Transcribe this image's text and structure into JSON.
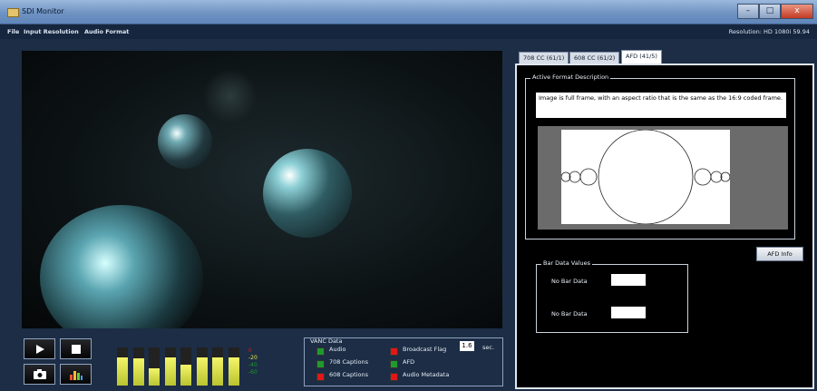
{
  "window": {
    "title": "SDI Monitor",
    "controls": {
      "minimize": "–",
      "maximize": "□",
      "close": "x"
    }
  },
  "menu": {
    "items": [
      "File",
      "Input Resolution",
      "Audio Format"
    ],
    "resolution": "Resolution: HD 1080i 59.94"
  },
  "meters": {
    "levels": [
      0.75,
      0.72,
      0.45,
      0.75,
      0.55,
      0.75,
      0.75,
      0.75
    ],
    "scale": [
      "0",
      "-20",
      "-40",
      "-60"
    ]
  },
  "vanc": {
    "title": "VANC Data",
    "items": [
      {
        "label": "Audio",
        "color": "#1f9a2e"
      },
      {
        "label": "708 Captions",
        "color": "#1f9a2e"
      },
      {
        "label": "608 Captions",
        "color": "#e01818"
      },
      {
        "label": "Broadcast Flag",
        "color": "#e01818"
      },
      {
        "label": "AFD",
        "color": "#1f9a2e"
      },
      {
        "label": "Audio Metadata",
        "color": "#e01818"
      }
    ],
    "broadcast_value": "1.6",
    "broadcast_unit": "sec."
  },
  "tabs": [
    "708 CC (61/1)",
    "608 CC (61/2)",
    "AFD (41/5)"
  ],
  "afd": {
    "group_label": "Active Format Description",
    "description": "Image is full frame, with an aspect ratio that is the same as the 16:9 coded frame.",
    "info_button": "AFD Info"
  },
  "bar_data": {
    "group_label": "Bar Data Values",
    "row1_label": "No Bar Data",
    "row2_label": "No Bar Data"
  },
  "colors": {
    "accent": "#1c2d45",
    "meter": "#e6e84a",
    "led_green": "#1f9a2e",
    "led_red": "#e01818"
  }
}
